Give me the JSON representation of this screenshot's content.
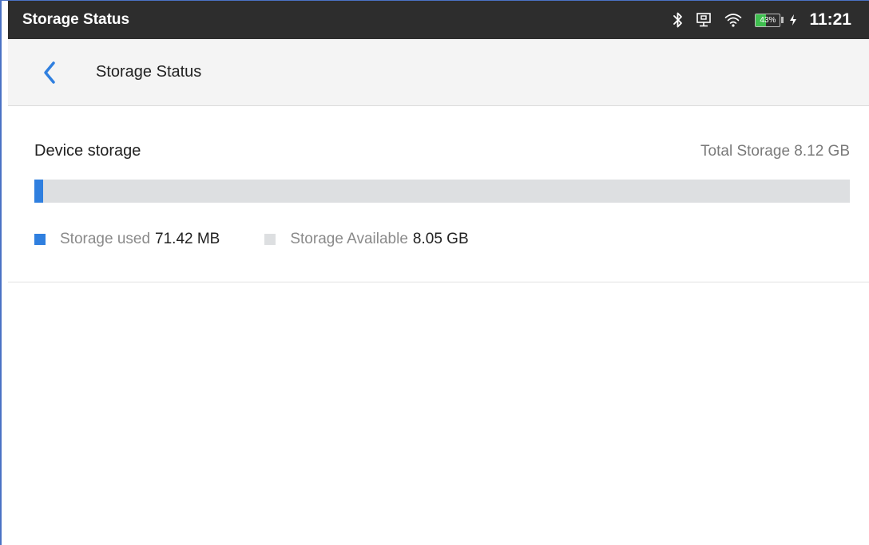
{
  "status_bar": {
    "title": "Storage Status",
    "battery_percent": "43%",
    "battery_level": 0.43,
    "time": "11:21",
    "icons": [
      "bluetooth-icon",
      "ethernet-icon",
      "wifi-icon",
      "battery-icon",
      "charging-icon"
    ]
  },
  "app_bar": {
    "back_icon": "chevron-left-icon",
    "title": "Storage Status"
  },
  "storage": {
    "label": "Device storage",
    "total_text": "Total Storage 8.12 GB",
    "used_fraction": 0.0086,
    "legend": [
      {
        "label": "Storage used",
        "value": "71.42 MB",
        "color": "#2f7fdf"
      },
      {
        "label": "Storage Available",
        "value": "8.05 GB",
        "color": "#dddfe1"
      }
    ]
  },
  "colors": {
    "status_bar_bg": "#2d2d2d",
    "accent": "#2f7fdf",
    "app_bar_bg": "#f4f4f4"
  }
}
